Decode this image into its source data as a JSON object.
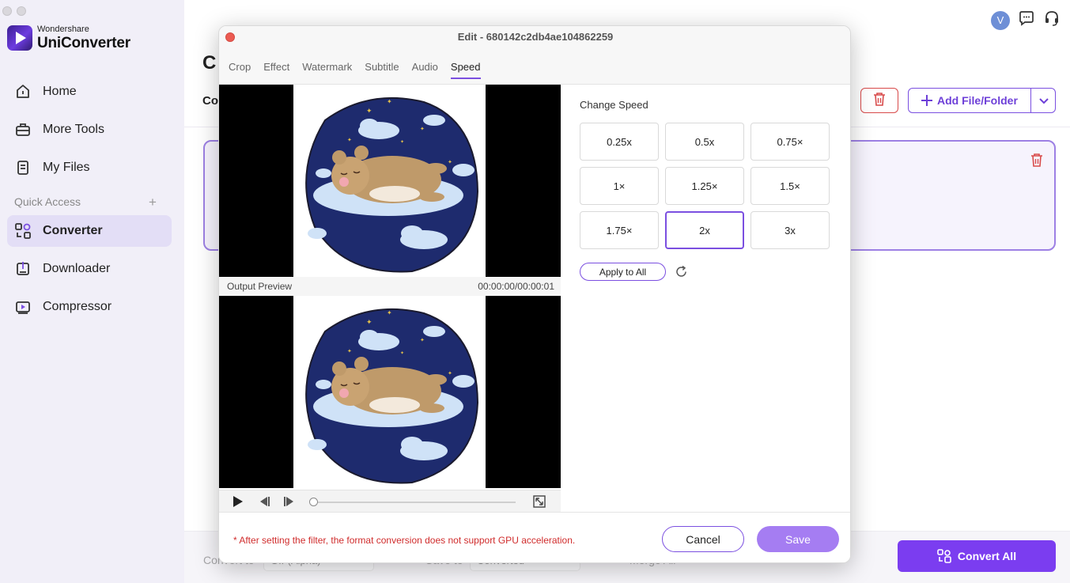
{
  "app": {
    "brand_small": "Wondershare",
    "brand_name": "UniConverter"
  },
  "sidebar": {
    "items": [
      {
        "label": "Home",
        "icon": "home-icon"
      },
      {
        "label": "More Tools",
        "icon": "toolbox-icon"
      },
      {
        "label": "My Files",
        "icon": "files-icon"
      },
      {
        "label": "Converter",
        "icon": "converter-icon",
        "active": true
      },
      {
        "label": "Downloader",
        "icon": "downloader-icon"
      },
      {
        "label": "Compressor",
        "icon": "compressor-icon"
      }
    ],
    "quick_access_label": "Quick Access",
    "quick_access_add": "+"
  },
  "header": {
    "avatar_letter": "V"
  },
  "main": {
    "heading_partial": "C",
    "subheading_partial": "Co",
    "add_button_label": "Add File/Folder",
    "convert_all_label": "Convert All",
    "bottom_convert_to": "Convert to",
    "bottom_format": "GIF(Alpha)",
    "bottom_save_to": "Save to",
    "bottom_folder": "Converted",
    "bottom_merge": "Merge All"
  },
  "modal": {
    "title": "Edit - 680142c2db4ae104862259",
    "tabs": [
      {
        "label": "Crop"
      },
      {
        "label": "Effect"
      },
      {
        "label": "Watermark"
      },
      {
        "label": "Subtitle"
      },
      {
        "label": "Audio"
      },
      {
        "label": "Speed",
        "active": true
      }
    ],
    "preview": {
      "output_label": "Output Preview",
      "time": "00:00:00/00:00:01",
      "progress": 0
    },
    "speed": {
      "label": "Change Speed",
      "options": [
        "0.25x",
        "0.5x",
        "0.75×",
        "1×",
        "1.25×",
        "1.5×",
        "1.75×",
        "2x",
        "3x"
      ],
      "selected": "2x",
      "apply_label": "Apply to All"
    },
    "footer": {
      "warning": "* After setting the filter, the format conversion does not support GPU acceleration.",
      "cancel_label": "Cancel",
      "save_label": "Save"
    }
  },
  "colors": {
    "accent": "#7b4fe0",
    "danger": "#d84a4a",
    "save": "#a57df2",
    "sidebar_bg": "#f1eff8"
  }
}
